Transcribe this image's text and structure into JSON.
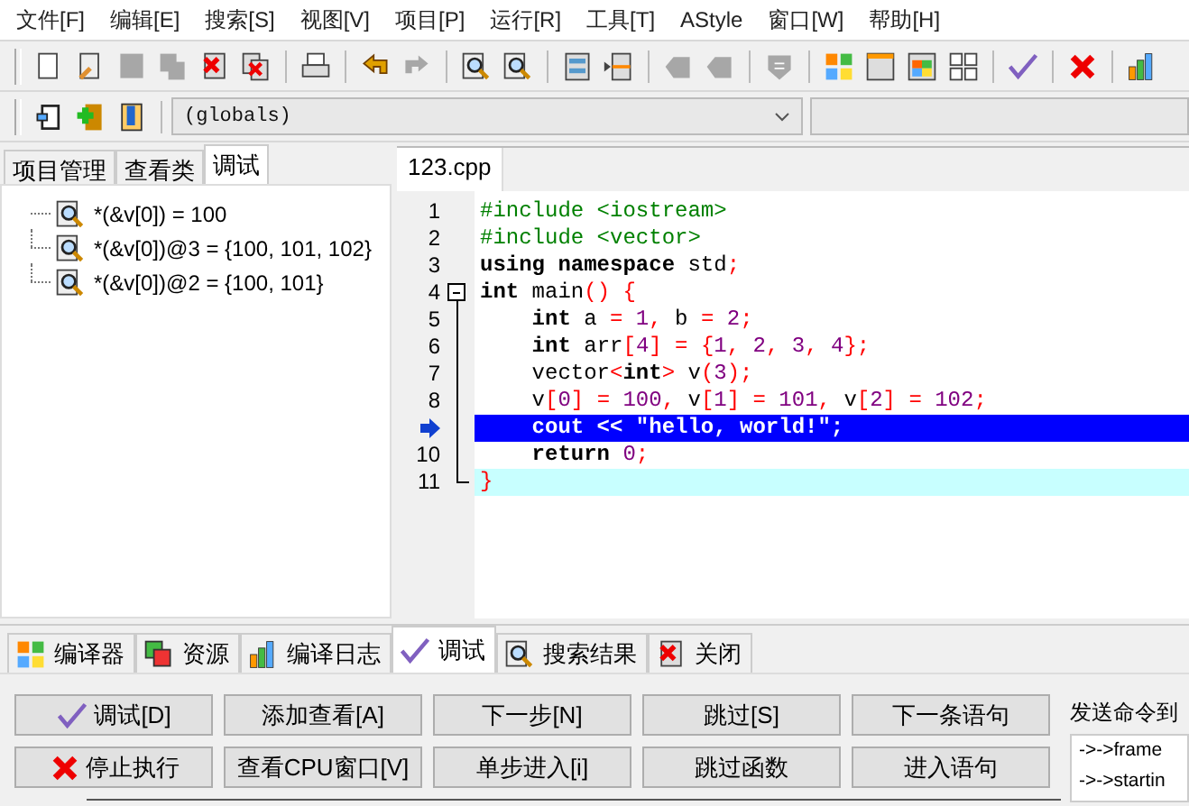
{
  "menu": [
    "文件[F]",
    "编辑[E]",
    "搜索[S]",
    "视图[V]",
    "项目[P]",
    "运行[R]",
    "工具[T]",
    "AStyle",
    "窗口[W]",
    "帮助[H]"
  ],
  "toolbar": [
    {
      "kind": "page",
      "disabled": false
    },
    {
      "kind": "notepad",
      "disabled": false
    },
    {
      "kind": "save",
      "disabled": true
    },
    {
      "kind": "save-all",
      "disabled": true
    },
    {
      "kind": "close-file",
      "disabled": false
    },
    {
      "kind": "close-all",
      "disabled": false
    },
    {
      "kind": "sep"
    },
    {
      "kind": "printer",
      "disabled": false
    },
    {
      "kind": "sep"
    },
    {
      "kind": "undo",
      "disabled": false
    },
    {
      "kind": "redo",
      "disabled": true
    },
    {
      "kind": "sep"
    },
    {
      "kind": "find",
      "disabled": false
    },
    {
      "kind": "find-next",
      "disabled": false
    },
    {
      "kind": "sep"
    },
    {
      "kind": "panel",
      "disabled": false
    },
    {
      "kind": "insert",
      "disabled": false
    },
    {
      "kind": "sep"
    },
    {
      "kind": "bookmark",
      "disabled": true
    },
    {
      "kind": "bookmark",
      "disabled": true
    },
    {
      "kind": "sep"
    },
    {
      "kind": "shield",
      "disabled": true
    },
    {
      "kind": "sep"
    },
    {
      "kind": "grid",
      "disabled": false
    },
    {
      "kind": "window",
      "disabled": false
    },
    {
      "kind": "color-window",
      "disabled": false
    },
    {
      "kind": "grid-outline",
      "disabled": false
    },
    {
      "kind": "sep"
    },
    {
      "kind": "check",
      "disabled": false
    },
    {
      "kind": "sep"
    },
    {
      "kind": "cross",
      "disabled": false
    },
    {
      "kind": "sep"
    },
    {
      "kind": "bar-chart",
      "disabled": false
    }
  ],
  "toolbar2": [
    {
      "kind": "exit-door",
      "disabled": false
    },
    {
      "kind": "add-file",
      "disabled": false
    },
    {
      "kind": "book",
      "disabled": false
    }
  ],
  "scope_combo": {
    "value": "(globals)"
  },
  "left_tabs": [
    {
      "label": "项目管理",
      "selected": false
    },
    {
      "label": "查看类",
      "selected": false
    },
    {
      "label": "调试",
      "selected": true
    }
  ],
  "watches": [
    "*(&v[0]) = 100",
    "*(&v[0])@3 = {100, 101, 102}",
    "*(&v[0])@2 = {100, 101}"
  ],
  "editor_tab": {
    "label": "123.cpp"
  },
  "code": [
    {
      "num": "1",
      "kind": "normal",
      "segs": [
        {
          "text": "#include <iostream>",
          "kind": "pre"
        }
      ]
    },
    {
      "num": "2",
      "kind": "normal",
      "segs": [
        {
          "text": "#include <vector>",
          "kind": "pre"
        }
      ]
    },
    {
      "num": "3",
      "kind": "normal",
      "segs": [
        {
          "text": "using namespace",
          "kind": "kw"
        },
        {
          "text": " std",
          "kind": "id"
        },
        {
          "text": ";",
          "kind": "op"
        }
      ]
    },
    {
      "num": "4",
      "kind": "normal",
      "segs": [
        {
          "text": "int",
          "kind": "kw"
        },
        {
          "text": " main",
          "kind": "id"
        },
        {
          "text": "() {",
          "kind": "op"
        }
      ]
    },
    {
      "num": "5",
      "kind": "normal",
      "segs": [
        {
          "text": "    int",
          "kind": "kw"
        },
        {
          "text": " a ",
          "kind": "id"
        },
        {
          "text": "=",
          "kind": "op"
        },
        {
          "text": " 1",
          "kind": "num"
        },
        {
          "text": ",",
          "kind": "op"
        },
        {
          "text": " b ",
          "kind": "id"
        },
        {
          "text": "=",
          "kind": "op"
        },
        {
          "text": " 2",
          "kind": "num"
        },
        {
          "text": ";",
          "kind": "op"
        }
      ]
    },
    {
      "num": "6",
      "kind": "normal",
      "segs": [
        {
          "text": "    int",
          "kind": "kw"
        },
        {
          "text": " arr",
          "kind": "id"
        },
        {
          "text": "[",
          "kind": "op"
        },
        {
          "text": "4",
          "kind": "num"
        },
        {
          "text": "] = {",
          "kind": "op"
        },
        {
          "text": "1",
          "kind": "num"
        },
        {
          "text": ", ",
          "kind": "op"
        },
        {
          "text": "2",
          "kind": "num"
        },
        {
          "text": ", ",
          "kind": "op"
        },
        {
          "text": "3",
          "kind": "num"
        },
        {
          "text": ", ",
          "kind": "op"
        },
        {
          "text": "4",
          "kind": "num"
        },
        {
          "text": "};",
          "kind": "op"
        }
      ]
    },
    {
      "num": "7",
      "kind": "normal",
      "segs": [
        {
          "text": "    vector",
          "kind": "id"
        },
        {
          "text": "<",
          "kind": "op"
        },
        {
          "text": "int",
          "kind": "kw"
        },
        {
          "text": ">",
          "kind": "op"
        },
        {
          "text": " v",
          "kind": "id"
        },
        {
          "text": "(",
          "kind": "op"
        },
        {
          "text": "3",
          "kind": "num"
        },
        {
          "text": ");",
          "kind": "op"
        }
      ]
    },
    {
      "num": "8",
      "kind": "normal",
      "segs": [
        {
          "text": "    v",
          "kind": "id"
        },
        {
          "text": "[",
          "kind": "op"
        },
        {
          "text": "0",
          "kind": "num"
        },
        {
          "text": "] = ",
          "kind": "op"
        },
        {
          "text": "100",
          "kind": "num"
        },
        {
          "text": ", ",
          "kind": "op"
        },
        {
          "text": "v",
          "kind": "id"
        },
        {
          "text": "[",
          "kind": "op"
        },
        {
          "text": "1",
          "kind": "num"
        },
        {
          "text": "] = ",
          "kind": "op"
        },
        {
          "text": "101",
          "kind": "num"
        },
        {
          "text": ", ",
          "kind": "op"
        },
        {
          "text": "v",
          "kind": "id"
        },
        {
          "text": "[",
          "kind": "op"
        },
        {
          "text": "2",
          "kind": "num"
        },
        {
          "text": "] = ",
          "kind": "op"
        },
        {
          "text": "102",
          "kind": "num"
        },
        {
          "text": ";",
          "kind": "op"
        }
      ]
    },
    {
      "kind": "current",
      "segs": [
        {
          "text": "    cout << \"hello, world!\";",
          "kind": "id"
        }
      ]
    },
    {
      "num": "10",
      "kind": "normal",
      "segs": [
        {
          "text": "    return",
          "kind": "kw"
        },
        {
          "text": " 0",
          "kind": "num"
        },
        {
          "text": ";",
          "kind": "op"
        }
      ]
    },
    {
      "num": "11",
      "kind": "caret",
      "segs": [
        {
          "text": "}",
          "kind": "op"
        }
      ]
    }
  ],
  "bottom_tabs": [
    {
      "label": "编译器",
      "selected": false
    },
    {
      "label": "资源",
      "selected": false
    },
    {
      "label": "编译日志",
      "selected": false
    },
    {
      "label": "调试",
      "selected": true
    },
    {
      "label": "搜索结果",
      "selected": false
    },
    {
      "label": "关闭",
      "selected": false
    }
  ],
  "debug_buttons": [
    "调试[D]",
    "添加查看[A]",
    "下一步[N]",
    "跳过[S]",
    "下一条语句",
    "停止执行",
    "查看CPU窗口[V]",
    "单步进入[i]",
    "跳过函数",
    "进入语句"
  ],
  "command_label": "发送命令到",
  "gdb_output": [
    "->->frame",
    "->->startin"
  ]
}
